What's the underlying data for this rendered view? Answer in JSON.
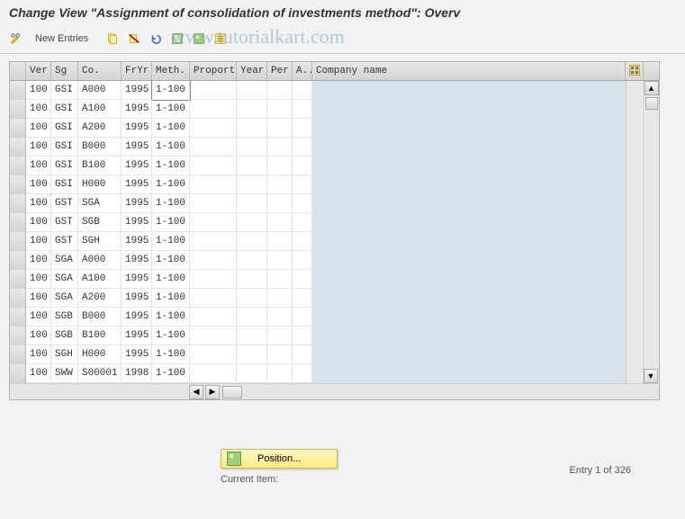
{
  "title": "Change View \"Assignment of consolidation of investments method\": Overv",
  "watermark": "www.tutorialkart.com",
  "toolbar": {
    "new_entries": "New Entries"
  },
  "columns": {
    "ver": "Ver",
    "sg": "Sg",
    "co": "Co.",
    "fryr": "FrYr",
    "meth": "Meth.",
    "proport": "Proport.",
    "year": "Year",
    "per": "Per",
    "a": "A...",
    "name": "Company name"
  },
  "rows": [
    {
      "ver": "100",
      "sg": "GSI",
      "co": "A000",
      "fryr": "1995",
      "meth": "1-100",
      "editing": true
    },
    {
      "ver": "100",
      "sg": "GSI",
      "co": "A100",
      "fryr": "1995",
      "meth": "1-100"
    },
    {
      "ver": "100",
      "sg": "GSI",
      "co": "A200",
      "fryr": "1995",
      "meth": "1-100"
    },
    {
      "ver": "100",
      "sg": "GSI",
      "co": "B000",
      "fryr": "1995",
      "meth": "1-100"
    },
    {
      "ver": "100",
      "sg": "GSI",
      "co": "B100",
      "fryr": "1995",
      "meth": "1-100"
    },
    {
      "ver": "100",
      "sg": "GSI",
      "co": "H000",
      "fryr": "1995",
      "meth": "1-100"
    },
    {
      "ver": "100",
      "sg": "GST",
      "co": "SGA",
      "fryr": "1995",
      "meth": "1-100"
    },
    {
      "ver": "100",
      "sg": "GST",
      "co": "SGB",
      "fryr": "1995",
      "meth": "1-100"
    },
    {
      "ver": "100",
      "sg": "GST",
      "co": "SGH",
      "fryr": "1995",
      "meth": "1-100"
    },
    {
      "ver": "100",
      "sg": "SGA",
      "co": "A000",
      "fryr": "1995",
      "meth": "1-100"
    },
    {
      "ver": "100",
      "sg": "SGA",
      "co": "A100",
      "fryr": "1995",
      "meth": "1-100"
    },
    {
      "ver": "100",
      "sg": "SGA",
      "co": "A200",
      "fryr": "1995",
      "meth": "1-100"
    },
    {
      "ver": "100",
      "sg": "SGB",
      "co": "B000",
      "fryr": "1995",
      "meth": "1-100"
    },
    {
      "ver": "100",
      "sg": "SGB",
      "co": "B100",
      "fryr": "1995",
      "meth": "1-100"
    },
    {
      "ver": "100",
      "sg": "SGH",
      "co": "H000",
      "fryr": "1995",
      "meth": "1-100"
    },
    {
      "ver": "100",
      "sg": "SWW",
      "co": "S00001",
      "fryr": "1998",
      "meth": "1-100"
    }
  ],
  "footer": {
    "position_label": "Position...",
    "current_item_label": "Current Item:",
    "entry_text": "Entry 1 of 326"
  }
}
